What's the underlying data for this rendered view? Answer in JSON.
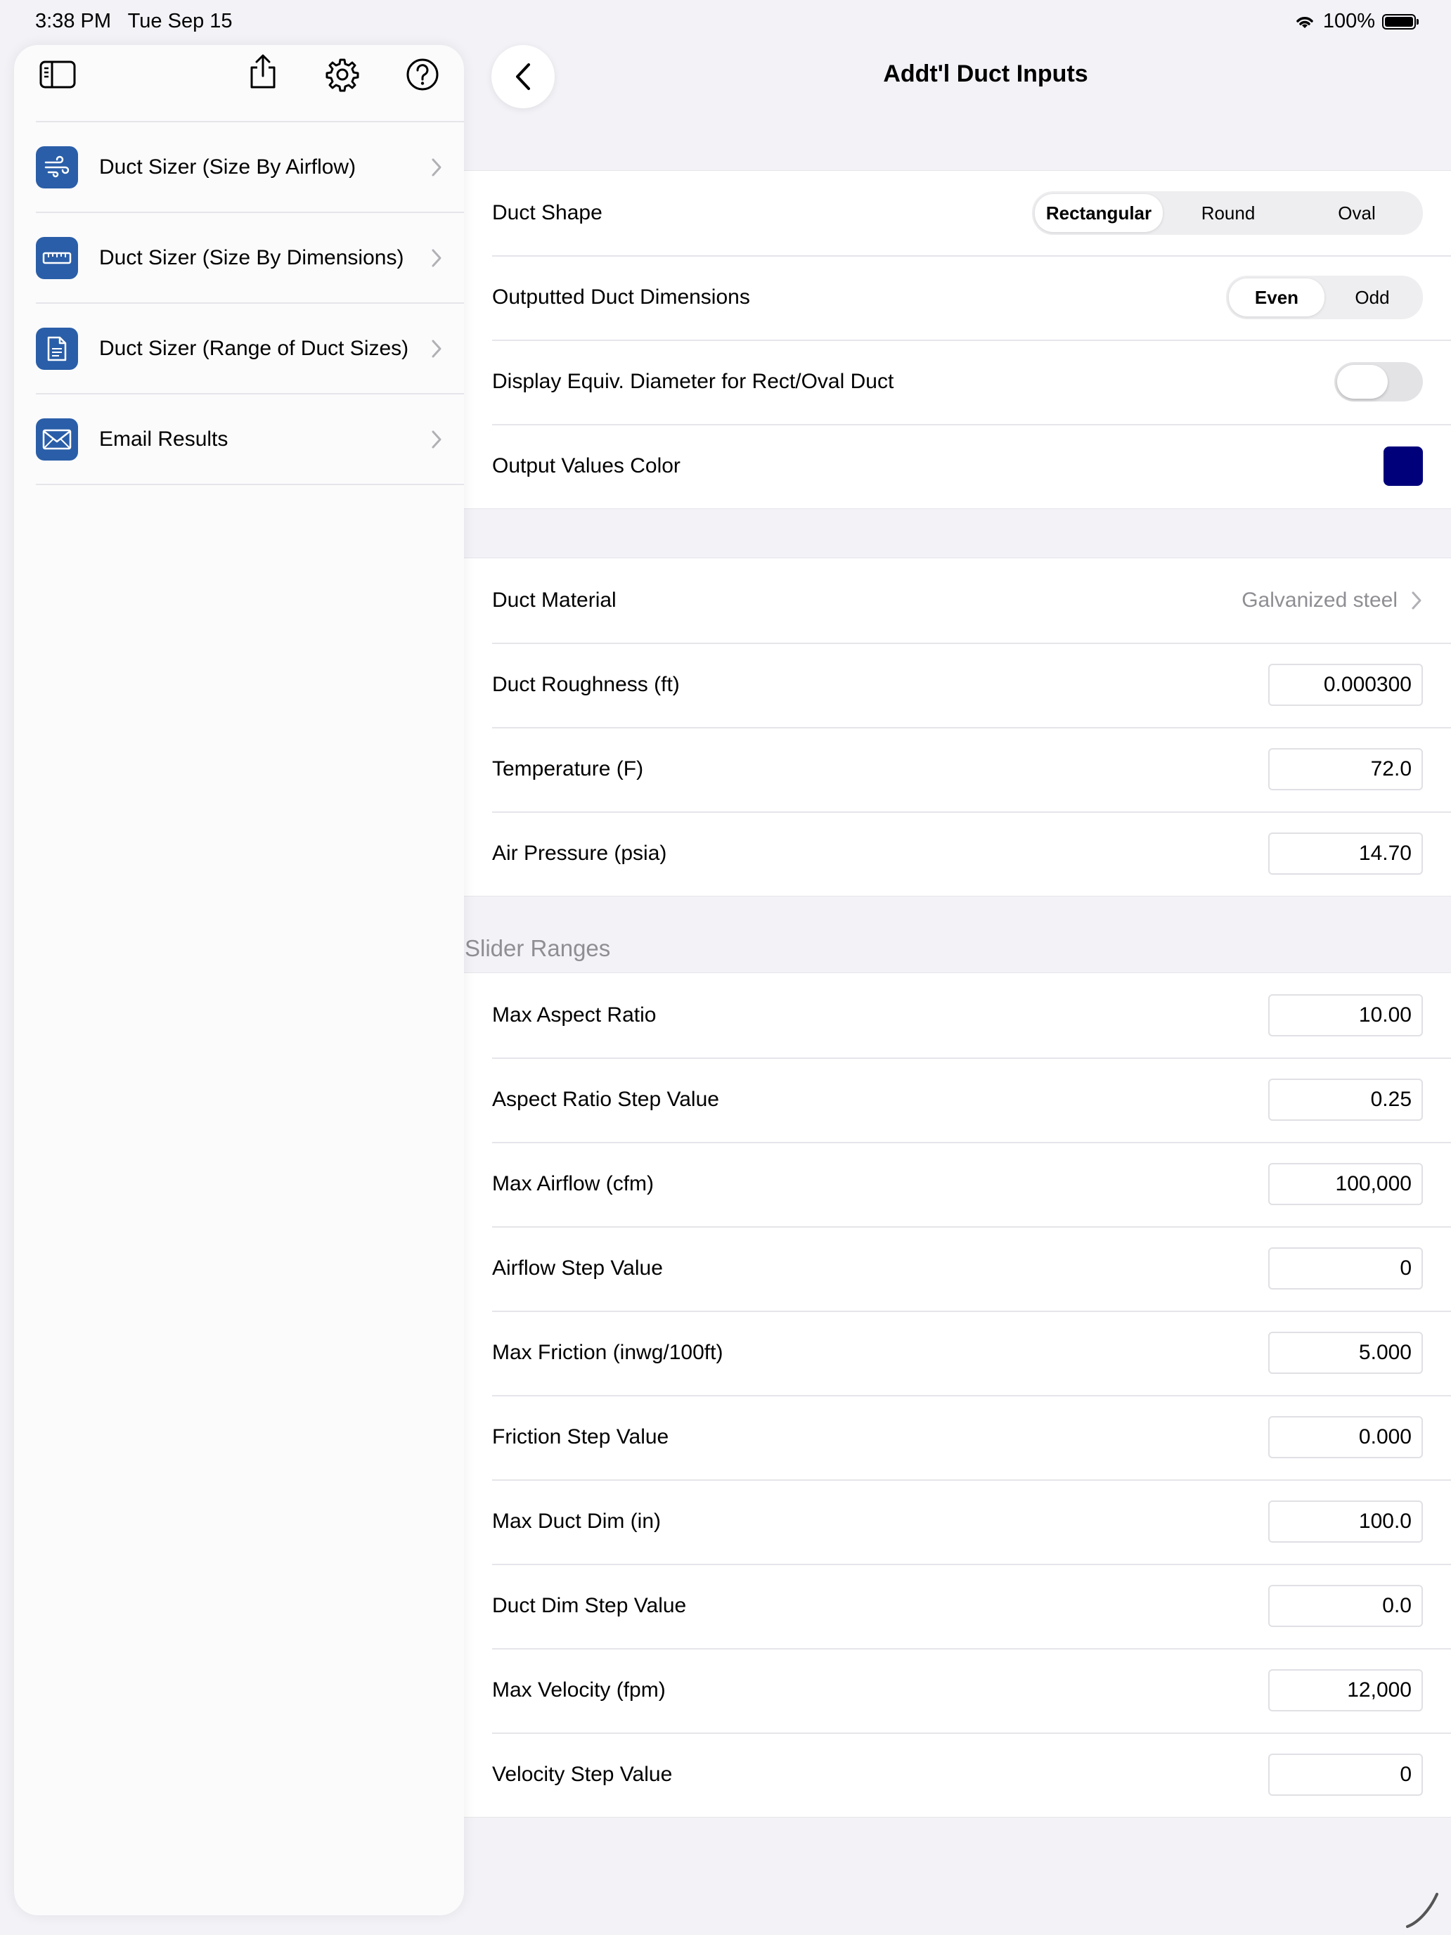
{
  "status_bar": {
    "time": "3:38 PM",
    "date": "Tue Sep 15",
    "battery": "100%",
    "battery_level": 1.0
  },
  "header": {
    "title": "Addt'l Duct Inputs"
  },
  "sidebar": {
    "items": [
      {
        "label": "Duct Sizer (Size By Airflow)",
        "icon": "wind-icon"
      },
      {
        "label": "Duct Sizer (Size By Dimensions)",
        "icon": "ruler-icon"
      },
      {
        "label": "Duct Sizer (Range of Duct Sizes)",
        "icon": "document-icon"
      },
      {
        "label": "Email Results",
        "icon": "envelope-icon"
      }
    ]
  },
  "display_section": {
    "duct_shape": {
      "label": "Duct Shape",
      "options": [
        "Rectangular",
        "Round",
        "Oval"
      ],
      "selected": "Rectangular"
    },
    "output_dims": {
      "label": "Outputted Duct Dimensions",
      "options": [
        "Even",
        "Odd"
      ],
      "selected": "Even"
    },
    "equiv_diameter": {
      "label": "Display Equiv. Diameter for Rect/Oval Duct",
      "on": false
    },
    "output_color": {
      "label": "Output Values Color",
      "color": "#00007a"
    }
  },
  "material_section": {
    "material": {
      "label": "Duct Material",
      "value": "Galvanized steel"
    },
    "roughness": {
      "label": "Duct Roughness (ft)",
      "value": "0.000300"
    },
    "temperature": {
      "label": "Temperature (F)",
      "value": "72.0"
    },
    "pressure": {
      "label": "Air Pressure (psia)",
      "value": "14.70"
    }
  },
  "slider_section": {
    "header": "Slider Ranges",
    "rows": [
      {
        "label": "Max Aspect Ratio",
        "value": "10.00"
      },
      {
        "label": "Aspect Ratio Step Value",
        "value": "0.25"
      },
      {
        "label": "Max Airflow (cfm)",
        "value": "100,000"
      },
      {
        "label": "Airflow Step Value",
        "value": "0"
      },
      {
        "label": "Max Friction (inwg/100ft)",
        "value": "5.000"
      },
      {
        "label": "Friction Step Value",
        "value": "0.000"
      },
      {
        "label": "Max Duct Dim (in)",
        "value": "100.0"
      },
      {
        "label": "Duct Dim Step Value",
        "value": "0.0"
      },
      {
        "label": "Max Velocity (fpm)",
        "value": "12,000"
      },
      {
        "label": "Velocity Step Value",
        "value": "0"
      }
    ]
  }
}
